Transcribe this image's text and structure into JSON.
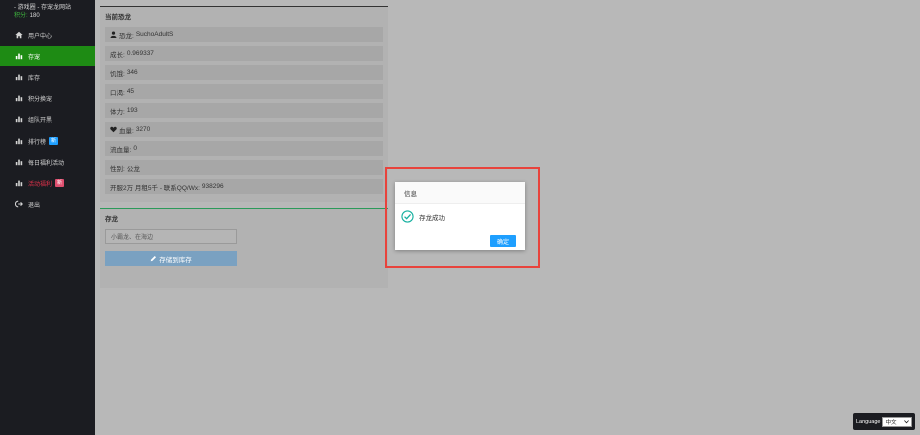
{
  "sidebar": {
    "brand_title": "- 游戏圈 - 存宠龙网站",
    "points_label": "积分:",
    "points_value": "180",
    "items": [
      {
        "label": "用户中心",
        "icon": "home-icon",
        "active": false
      },
      {
        "label": "存宠",
        "icon": "bar-chart-icon",
        "active": true
      },
      {
        "label": "库存",
        "icon": "bar-chart-icon",
        "active": false
      },
      {
        "label": "积分换宠",
        "icon": "bar-chart-icon",
        "active": false
      },
      {
        "label": "组队开黑",
        "icon": "bar-chart-icon",
        "active": false
      },
      {
        "label": "排行榜",
        "icon": "bar-chart-icon",
        "active": false,
        "badge": "新",
        "badge_color": "#1e9fff"
      },
      {
        "label": "每日福利活动",
        "icon": "bar-chart-icon",
        "active": false
      },
      {
        "label": "活动福利",
        "icon": "bar-chart-icon",
        "active": false,
        "badge": "新",
        "badge_color": "#e04f6f",
        "label_color": "#e2324b"
      },
      {
        "label": "退出",
        "icon": "logout-icon",
        "active": false
      }
    ]
  },
  "pet_panel": {
    "title": "当前恐龙",
    "rows": [
      {
        "label": "恐龙:",
        "value": "SuchoAdultS",
        "icon": "user-icon"
      },
      {
        "label": "成长:",
        "value": "0.969337"
      },
      {
        "label": "饥饿:",
        "value": "346"
      },
      {
        "label": "口渴:",
        "value": "45"
      },
      {
        "label": "体力:",
        "value": "193"
      },
      {
        "label": "血量:",
        "value": "3270",
        "icon": "heart-icon"
      },
      {
        "label": "流血量:",
        "value": "0"
      },
      {
        "label": "性别:",
        "value": "公龙"
      },
      {
        "label": "开服2万 月租5千 - 联系QQ/Wx:",
        "value": "938296"
      }
    ]
  },
  "store_panel": {
    "title": "存龙",
    "input_placeholder": "小霸龙、在海边",
    "button_label": "存储到库存"
  },
  "dialog": {
    "title": "信息",
    "message": "存龙成功",
    "confirm_label": "确定"
  },
  "language": {
    "label": "Language",
    "selected": "中文"
  },
  "colors": {
    "sidebar_bg": "#1b1c21",
    "active_nav": "#1e8b14",
    "primary_blue": "#1e9fff",
    "highlight_red": "#e8433c",
    "success_teal": "#16b0a0"
  }
}
